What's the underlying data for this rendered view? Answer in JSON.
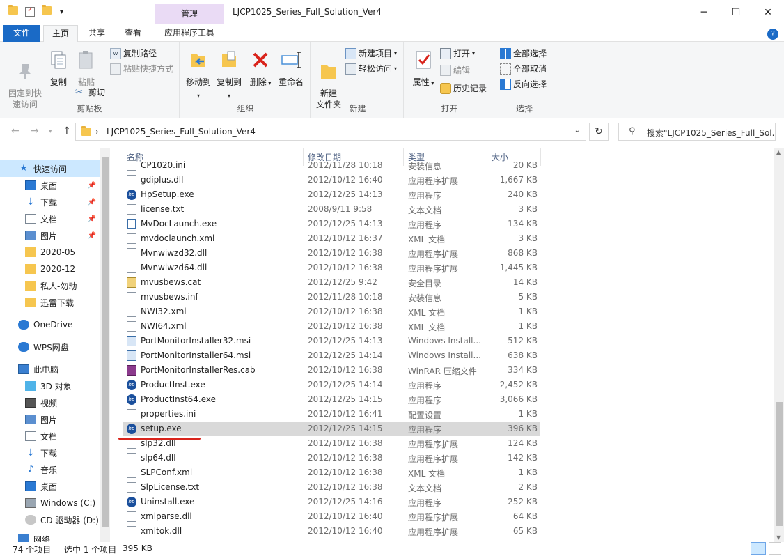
{
  "window": {
    "title": "LJCP1025_Series_Full_Solution_Ver4",
    "manage_tab": "管理",
    "controls": {
      "minimize": "─",
      "maximize": "☐",
      "close": "✕"
    }
  },
  "tabs": {
    "file": "文件",
    "home": "主页",
    "share": "共享",
    "view": "查看",
    "app_tools": "应用程序工具",
    "help": "?"
  },
  "ribbon": {
    "clipboard": {
      "label": "剪贴板",
      "pin": "固定到快\n速访问",
      "copy": "复制",
      "paste": "粘贴",
      "copy_path": "复制路径",
      "paste_shortcut": "粘贴快捷方式",
      "cut": "剪切"
    },
    "organize": {
      "label": "组织",
      "move_to": "移动到",
      "copy_to": "复制到",
      "delete": "删除",
      "rename": "重命名"
    },
    "new": {
      "label": "新建",
      "new_folder": "新建\n文件夹",
      "new_item": "新建项目",
      "easy_access": "轻松访问"
    },
    "open": {
      "label": "打开",
      "properties": "属性",
      "open": "打开",
      "edit": "编辑",
      "history": "历史记录"
    },
    "select": {
      "label": "选择",
      "select_all": "全部选择",
      "select_none": "全部取消",
      "invert": "反向选择"
    }
  },
  "address": {
    "path": "LJCP1025_Series_Full_Solution_Ver4",
    "search_placeholder": "搜索\"LJCP1025_Series_Full_Sol..."
  },
  "nav": [
    {
      "label": "快速访问",
      "icon": "star-icon"
    },
    {
      "label": "桌面",
      "icon": "desktop-icon",
      "pinned": true
    },
    {
      "label": "下载",
      "icon": "download-icon",
      "pinned": true
    },
    {
      "label": "文档",
      "icon": "document-icon",
      "pinned": true
    },
    {
      "label": "图片",
      "icon": "picture-icon",
      "pinned": true
    },
    {
      "label": "2020-05",
      "icon": "folder-icon"
    },
    {
      "label": "2020-12",
      "icon": "folder-icon"
    },
    {
      "label": "私人-勿动",
      "icon": "folder-icon"
    },
    {
      "label": "迅雷下载",
      "icon": "folder-icon"
    },
    {
      "label": "OneDrive",
      "icon": "cloud-icon"
    },
    {
      "label": "WPS网盘",
      "icon": "cloud-icon"
    },
    {
      "label": "此电脑",
      "icon": "computer-icon"
    },
    {
      "label": "3D 对象",
      "icon": "cube-icon"
    },
    {
      "label": "视频",
      "icon": "video-icon"
    },
    {
      "label": "图片",
      "icon": "picture-icon"
    },
    {
      "label": "文档",
      "icon": "document-icon"
    },
    {
      "label": "下载",
      "icon": "download-icon"
    },
    {
      "label": "音乐",
      "icon": "music-icon"
    },
    {
      "label": "桌面",
      "icon": "desktop-icon"
    },
    {
      "label": "Windows (C:)",
      "icon": "drive-icon"
    },
    {
      "label": "CD 驱动器 (D:)",
      "icon": "cd-icon"
    },
    {
      "label": "网络",
      "icon": "network-icon"
    }
  ],
  "columns": {
    "name": "名称",
    "date": "修改日期",
    "type": "类型",
    "size": "大小"
  },
  "files": [
    {
      "name": "CP1020.ini",
      "date": "2012/11/28 10:18",
      "type": "安装信息",
      "size": "20 KB",
      "icon": "ini"
    },
    {
      "name": "gdiplus.dll",
      "date": "2012/10/12 16:40",
      "type": "应用程序扩展",
      "size": "1,667 KB",
      "icon": "dll"
    },
    {
      "name": "HpSetup.exe",
      "date": "2012/12/25 14:13",
      "type": "应用程序",
      "size": "240 KB",
      "icon": "hp"
    },
    {
      "name": "license.txt",
      "date": "2008/9/11 9:58",
      "type": "文本文档",
      "size": "3 KB",
      "icon": "txt"
    },
    {
      "name": "MvDocLaunch.exe",
      "date": "2012/12/25 14:13",
      "type": "应用程序",
      "size": "134 KB",
      "icon": "exe"
    },
    {
      "name": "mvdoclaunch.xml",
      "date": "2012/10/12 16:37",
      "type": "XML 文档",
      "size": "3 KB",
      "icon": "xml"
    },
    {
      "name": "Mvnwiwzd32.dll",
      "date": "2012/10/12 16:38",
      "type": "应用程序扩展",
      "size": "868 KB",
      "icon": "dll"
    },
    {
      "name": "Mvnwiwzd64.dll",
      "date": "2012/10/12 16:38",
      "type": "应用程序扩展",
      "size": "1,445 KB",
      "icon": "dll"
    },
    {
      "name": "mvusbews.cat",
      "date": "2012/12/25 9:42",
      "type": "安全目录",
      "size": "14 KB",
      "icon": "cat"
    },
    {
      "name": "mvusbews.inf",
      "date": "2012/11/28 10:18",
      "type": "安装信息",
      "size": "5 KB",
      "icon": "ini"
    },
    {
      "name": "NWI32.xml",
      "date": "2012/10/12 16:38",
      "type": "XML 文档",
      "size": "1 KB",
      "icon": "xml"
    },
    {
      "name": "NWI64.xml",
      "date": "2012/10/12 16:38",
      "type": "XML 文档",
      "size": "1 KB",
      "icon": "xml"
    },
    {
      "name": "PortMonitorInstaller32.msi",
      "date": "2012/12/25 14:13",
      "type": "Windows Install...",
      "size": "512 KB",
      "icon": "msi"
    },
    {
      "name": "PortMonitorInstaller64.msi",
      "date": "2012/12/25 14:14",
      "type": "Windows Install...",
      "size": "638 KB",
      "icon": "msi"
    },
    {
      "name": "PortMonitorInstallerRes.cab",
      "date": "2012/10/12 16:38",
      "type": "WinRAR 压缩文件",
      "size": "334 KB",
      "icon": "cab"
    },
    {
      "name": "ProductInst.exe",
      "date": "2012/12/25 14:14",
      "type": "应用程序",
      "size": "2,452 KB",
      "icon": "hp"
    },
    {
      "name": "ProductInst64.exe",
      "date": "2012/12/25 14:15",
      "type": "应用程序",
      "size": "3,066 KB",
      "icon": "hp"
    },
    {
      "name": "properties.ini",
      "date": "2012/10/12 16:41",
      "type": "配置设置",
      "size": "1 KB",
      "icon": "ini"
    },
    {
      "name": "setup.exe",
      "date": "2012/12/25 14:15",
      "type": "应用程序",
      "size": "396 KB",
      "icon": "hp",
      "selected": true
    },
    {
      "name": "slp32.dll",
      "date": "2012/10/12 16:38",
      "type": "应用程序扩展",
      "size": "124 KB",
      "icon": "dll"
    },
    {
      "name": "slp64.dll",
      "date": "2012/10/12 16:38",
      "type": "应用程序扩展",
      "size": "142 KB",
      "icon": "dll"
    },
    {
      "name": "SLPConf.xml",
      "date": "2012/10/12 16:38",
      "type": "XML 文档",
      "size": "1 KB",
      "icon": "xml"
    },
    {
      "name": "SlpLicense.txt",
      "date": "2012/10/12 16:38",
      "type": "文本文档",
      "size": "2 KB",
      "icon": "txt"
    },
    {
      "name": "Uninstall.exe",
      "date": "2012/12/25 14:16",
      "type": "应用程序",
      "size": "252 KB",
      "icon": "hp"
    },
    {
      "name": "xmlparse.dll",
      "date": "2012/10/12 16:40",
      "type": "应用程序扩展",
      "size": "64 KB",
      "icon": "dll"
    },
    {
      "name": "xmltok.dll",
      "date": "2012/10/12 16:40",
      "type": "应用程序扩展",
      "size": "65 KB",
      "icon": "dll"
    }
  ],
  "status": {
    "count": "74 个项目",
    "selected": "选中 1 个项目",
    "size": "395 KB"
  },
  "colors": {
    "accent": "#1a6ac6",
    "selection": "#d9d9d9",
    "nav_selection": "#cce8ff",
    "manage": "#eadbf5",
    "annotation": "#d9241c"
  }
}
